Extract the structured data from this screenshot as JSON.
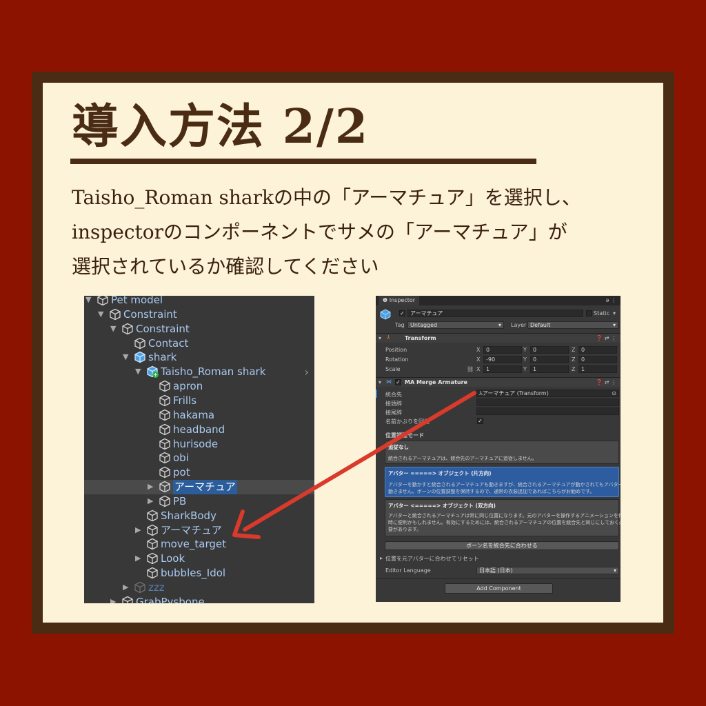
{
  "slide": {
    "title": "導入方法 2/2",
    "line1": "Taisho_Roman sharkの中の「アーマチュア」を選択し、",
    "line2": "inspectorのコンポーネントでサメの「アーマチュア」が",
    "line3": "選択されているか確認してください"
  },
  "hierarchy": {
    "rows": [
      {
        "label": "Pet model"
      },
      {
        "label": "Constraint"
      },
      {
        "label": "Constraint"
      },
      {
        "label": "Contact"
      },
      {
        "label": "shark"
      },
      {
        "label": "Taisho_Roman shark"
      },
      {
        "label": "apron"
      },
      {
        "label": "Frills"
      },
      {
        "label": "hakama"
      },
      {
        "label": "headband"
      },
      {
        "label": "hurisode"
      },
      {
        "label": "obi"
      },
      {
        "label": "pot"
      },
      {
        "label": "アーマチュア"
      },
      {
        "label": "PB"
      },
      {
        "label": "SharkBody"
      },
      {
        "label": "アーマチュア"
      },
      {
        "label": "move_target"
      },
      {
        "label": "Look"
      },
      {
        "label": "bubbles_Idol"
      },
      {
        "label": "zzz"
      },
      {
        "label": "GrabPysbone"
      }
    ]
  },
  "inspector": {
    "tab": "Inspector",
    "object_name": "アーマチュア",
    "static_label": "Static",
    "tag_label": "Tag",
    "tag_value": "Untagged",
    "layer_label": "Layer",
    "layer_value": "Default",
    "transform": {
      "header": "Transform",
      "position_label": "Position",
      "rotation_label": "Rotation",
      "scale_label": "Scale",
      "position": [
        "0",
        "0",
        "0"
      ],
      "rotation": [
        "-90",
        "0",
        "0"
      ],
      "scale": [
        "1",
        "1",
        "1"
      ],
      "axes": [
        "X",
        "Y",
        "Z"
      ]
    },
    "merge": {
      "header": "MA Merge Armature",
      "target_label": "統合先",
      "target_value": "アーマチュア (Transform)",
      "prefix_label": "接頭辞",
      "suffix_label": "接尾辞",
      "avoid_label": "名前かぶりを回避",
      "mode_label": "位置調整モード",
      "opt1_title": "追従なし",
      "opt1_desc": "統合されるアーマチュアは、統合先のアーマチュアに追従しません。",
      "opt2_title": "アバター =====> オブジェクト (片方向)",
      "opt2_desc1": "アバターを動かすと統合されるアーマチュアも動きますが、統合されるアーマチュアが動かされてもアバターは",
      "opt2_desc2": "動きません。ボーンの位置調整を保持するので、通常の衣装追加であればこちらがお勧めです。",
      "opt3_title": "アバター <=====> オブジェクト (双方向)",
      "opt3_desc1": "アバターと統合されるアーマチュアは常に同じ位置になります。元のアバターを操作するアニメーションを作る",
      "opt3_desc2": "時に便利かもしれません。有効にするためには、統合されるアーマチュアの位置を統合先と同じにしておく必",
      "opt3_desc3": "要があります。",
      "match_button": "ボーン名を統合先に合わせる",
      "reset_label": "位置を元アバターに合わせてリセット",
      "lang_label": "Editor Language",
      "lang_value": "日本語 (日本)"
    },
    "add_component": "Add Component"
  },
  "colors": {
    "background": "#8b1300",
    "frame": "#4a2c14",
    "card": "#fdf3d8",
    "arrow": "#d93a2b",
    "selection": "#2b5d9b"
  }
}
